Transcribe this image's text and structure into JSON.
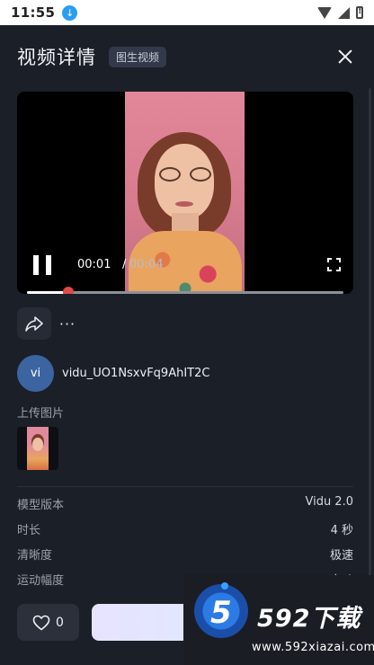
{
  "status_bar": {
    "time": "11:55",
    "icons": [
      "download-icon",
      "wifi-icon",
      "signal-icon",
      "battery-icon"
    ]
  },
  "header": {
    "title": "视频详情",
    "tag": "图生视频"
  },
  "player": {
    "state": "playing",
    "current_time": "00:01",
    "separator": "/",
    "total_time": "00:04",
    "progress_fraction": 0.13
  },
  "actions": {
    "more_label": "···"
  },
  "user": {
    "avatar_text": "vi",
    "name": "vidu_UO1NsxvFq9AhIT2C"
  },
  "upload": {
    "label": "上传图片"
  },
  "details": [
    {
      "key": "模型版本",
      "value": "Vidu 2.0"
    },
    {
      "key": "时长",
      "value": "4 秒"
    },
    {
      "key": "清晰度",
      "value": "极速"
    },
    {
      "key": "运动幅度",
      "value": "自动"
    }
  ],
  "footer": {
    "like_count": "0"
  },
  "watermark": {
    "logo_digit": "5",
    "brand": "592下载",
    "url": "www.592xiazai.com"
  },
  "colors": {
    "background": "#1b1f28",
    "accent_thumb": "#e24a4a",
    "avatar": "#3b64a0"
  }
}
